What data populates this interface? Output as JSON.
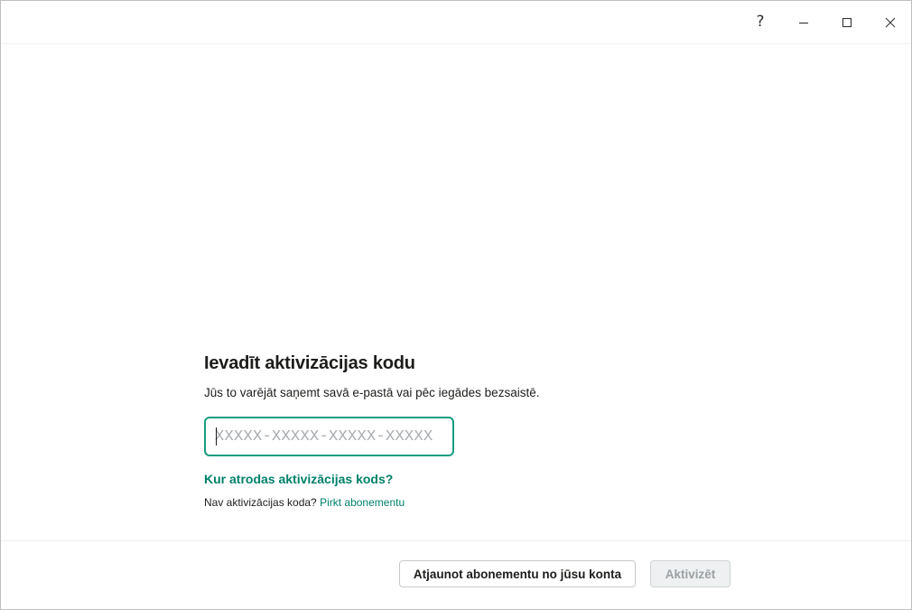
{
  "titlebar": {
    "help_glyph": "?",
    "icons": [
      "help-icon",
      "minimize-icon",
      "maximize-icon",
      "close-icon"
    ]
  },
  "main": {
    "heading": "Ievadīt aktivizācijas kodu",
    "subtext": "Jūs to varējāt saņemt savā e-pastā vai pēc iegādes bezsaistē.",
    "code_input": {
      "value": "",
      "placeholder": "XXXXX-XXXXX-XXXXX-XXXXX"
    },
    "where_link": "Kur atrodas aktivizācijas kods?",
    "no_code_label": "Nav aktivizācijas koda?",
    "buy_link": "Pirkt abonementu"
  },
  "footer": {
    "restore_button": "Atjaunot abonementu no jūsu konta",
    "activate_button": "Aktivizēt"
  },
  "colors": {
    "accent": "#00806b",
    "input_border": "#1a9c80",
    "disabled_text": "#9ba0a3"
  }
}
